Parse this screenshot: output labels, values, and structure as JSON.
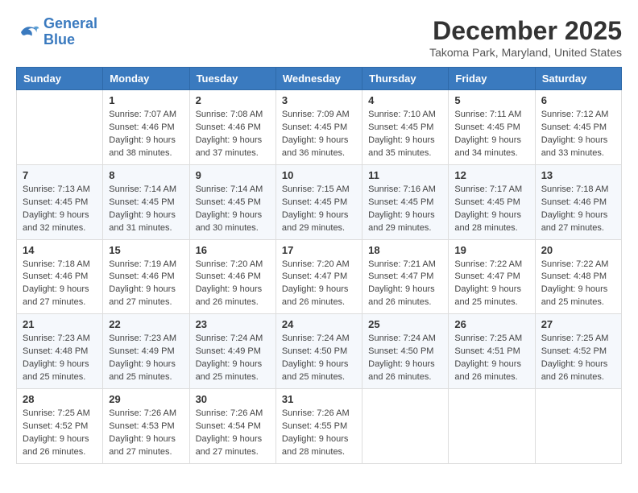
{
  "logo": {
    "line1": "General",
    "line2": "Blue"
  },
  "title": "December 2025",
  "location": "Takoma Park, Maryland, United States",
  "days_header": [
    "Sunday",
    "Monday",
    "Tuesday",
    "Wednesday",
    "Thursday",
    "Friday",
    "Saturday"
  ],
  "weeks": [
    [
      {
        "num": "",
        "sunrise": "",
        "sunset": "",
        "daylight": ""
      },
      {
        "num": "1",
        "sunrise": "Sunrise: 7:07 AM",
        "sunset": "Sunset: 4:46 PM",
        "daylight": "Daylight: 9 hours and 38 minutes."
      },
      {
        "num": "2",
        "sunrise": "Sunrise: 7:08 AM",
        "sunset": "Sunset: 4:46 PM",
        "daylight": "Daylight: 9 hours and 37 minutes."
      },
      {
        "num": "3",
        "sunrise": "Sunrise: 7:09 AM",
        "sunset": "Sunset: 4:45 PM",
        "daylight": "Daylight: 9 hours and 36 minutes."
      },
      {
        "num": "4",
        "sunrise": "Sunrise: 7:10 AM",
        "sunset": "Sunset: 4:45 PM",
        "daylight": "Daylight: 9 hours and 35 minutes."
      },
      {
        "num": "5",
        "sunrise": "Sunrise: 7:11 AM",
        "sunset": "Sunset: 4:45 PM",
        "daylight": "Daylight: 9 hours and 34 minutes."
      },
      {
        "num": "6",
        "sunrise": "Sunrise: 7:12 AM",
        "sunset": "Sunset: 4:45 PM",
        "daylight": "Daylight: 9 hours and 33 minutes."
      }
    ],
    [
      {
        "num": "7",
        "sunrise": "Sunrise: 7:13 AM",
        "sunset": "Sunset: 4:45 PM",
        "daylight": "Daylight: 9 hours and 32 minutes."
      },
      {
        "num": "8",
        "sunrise": "Sunrise: 7:14 AM",
        "sunset": "Sunset: 4:45 PM",
        "daylight": "Daylight: 9 hours and 31 minutes."
      },
      {
        "num": "9",
        "sunrise": "Sunrise: 7:14 AM",
        "sunset": "Sunset: 4:45 PM",
        "daylight": "Daylight: 9 hours and 30 minutes."
      },
      {
        "num": "10",
        "sunrise": "Sunrise: 7:15 AM",
        "sunset": "Sunset: 4:45 PM",
        "daylight": "Daylight: 9 hours and 29 minutes."
      },
      {
        "num": "11",
        "sunrise": "Sunrise: 7:16 AM",
        "sunset": "Sunset: 4:45 PM",
        "daylight": "Daylight: 9 hours and 29 minutes."
      },
      {
        "num": "12",
        "sunrise": "Sunrise: 7:17 AM",
        "sunset": "Sunset: 4:45 PM",
        "daylight": "Daylight: 9 hours and 28 minutes."
      },
      {
        "num": "13",
        "sunrise": "Sunrise: 7:18 AM",
        "sunset": "Sunset: 4:46 PM",
        "daylight": "Daylight: 9 hours and 27 minutes."
      }
    ],
    [
      {
        "num": "14",
        "sunrise": "Sunrise: 7:18 AM",
        "sunset": "Sunset: 4:46 PM",
        "daylight": "Daylight: 9 hours and 27 minutes."
      },
      {
        "num": "15",
        "sunrise": "Sunrise: 7:19 AM",
        "sunset": "Sunset: 4:46 PM",
        "daylight": "Daylight: 9 hours and 27 minutes."
      },
      {
        "num": "16",
        "sunrise": "Sunrise: 7:20 AM",
        "sunset": "Sunset: 4:46 PM",
        "daylight": "Daylight: 9 hours and 26 minutes."
      },
      {
        "num": "17",
        "sunrise": "Sunrise: 7:20 AM",
        "sunset": "Sunset: 4:47 PM",
        "daylight": "Daylight: 9 hours and 26 minutes."
      },
      {
        "num": "18",
        "sunrise": "Sunrise: 7:21 AM",
        "sunset": "Sunset: 4:47 PM",
        "daylight": "Daylight: 9 hours and 26 minutes."
      },
      {
        "num": "19",
        "sunrise": "Sunrise: 7:22 AM",
        "sunset": "Sunset: 4:47 PM",
        "daylight": "Daylight: 9 hours and 25 minutes."
      },
      {
        "num": "20",
        "sunrise": "Sunrise: 7:22 AM",
        "sunset": "Sunset: 4:48 PM",
        "daylight": "Daylight: 9 hours and 25 minutes."
      }
    ],
    [
      {
        "num": "21",
        "sunrise": "Sunrise: 7:23 AM",
        "sunset": "Sunset: 4:48 PM",
        "daylight": "Daylight: 9 hours and 25 minutes."
      },
      {
        "num": "22",
        "sunrise": "Sunrise: 7:23 AM",
        "sunset": "Sunset: 4:49 PM",
        "daylight": "Daylight: 9 hours and 25 minutes."
      },
      {
        "num": "23",
        "sunrise": "Sunrise: 7:24 AM",
        "sunset": "Sunset: 4:49 PM",
        "daylight": "Daylight: 9 hours and 25 minutes."
      },
      {
        "num": "24",
        "sunrise": "Sunrise: 7:24 AM",
        "sunset": "Sunset: 4:50 PM",
        "daylight": "Daylight: 9 hours and 25 minutes."
      },
      {
        "num": "25",
        "sunrise": "Sunrise: 7:24 AM",
        "sunset": "Sunset: 4:50 PM",
        "daylight": "Daylight: 9 hours and 26 minutes."
      },
      {
        "num": "26",
        "sunrise": "Sunrise: 7:25 AM",
        "sunset": "Sunset: 4:51 PM",
        "daylight": "Daylight: 9 hours and 26 minutes."
      },
      {
        "num": "27",
        "sunrise": "Sunrise: 7:25 AM",
        "sunset": "Sunset: 4:52 PM",
        "daylight": "Daylight: 9 hours and 26 minutes."
      }
    ],
    [
      {
        "num": "28",
        "sunrise": "Sunrise: 7:25 AM",
        "sunset": "Sunset: 4:52 PM",
        "daylight": "Daylight: 9 hours and 26 minutes."
      },
      {
        "num": "29",
        "sunrise": "Sunrise: 7:26 AM",
        "sunset": "Sunset: 4:53 PM",
        "daylight": "Daylight: 9 hours and 27 minutes."
      },
      {
        "num": "30",
        "sunrise": "Sunrise: 7:26 AM",
        "sunset": "Sunset: 4:54 PM",
        "daylight": "Daylight: 9 hours and 27 minutes."
      },
      {
        "num": "31",
        "sunrise": "Sunrise: 7:26 AM",
        "sunset": "Sunset: 4:55 PM",
        "daylight": "Daylight: 9 hours and 28 minutes."
      },
      {
        "num": "",
        "sunrise": "",
        "sunset": "",
        "daylight": ""
      },
      {
        "num": "",
        "sunrise": "",
        "sunset": "",
        "daylight": ""
      },
      {
        "num": "",
        "sunrise": "",
        "sunset": "",
        "daylight": ""
      }
    ]
  ]
}
